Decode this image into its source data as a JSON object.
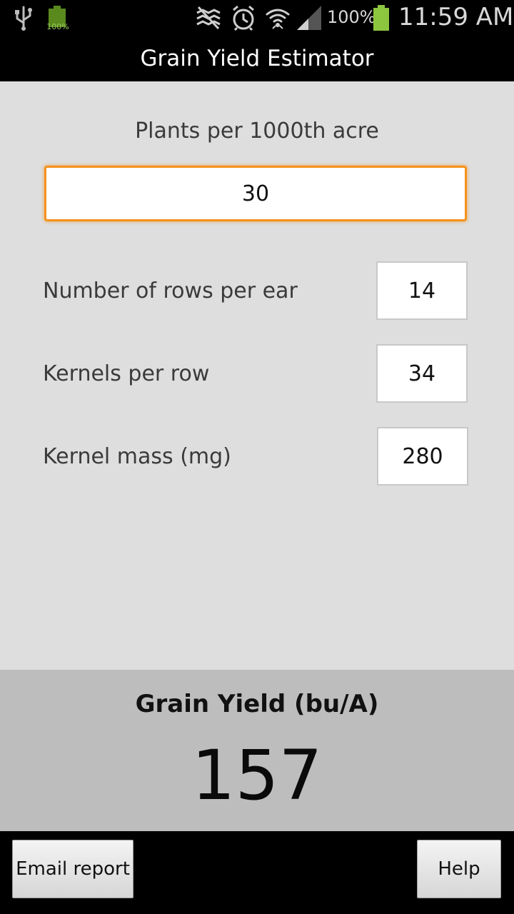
{
  "status_bar": {
    "battery_small_label": "100%",
    "battery_percent": "100%",
    "time": "11:59 AM",
    "icons": [
      "usb-icon",
      "battery-small-icon",
      "mute-icon",
      "alarm-icon",
      "wifi-icon",
      "signal-icon",
      "battery-icon"
    ],
    "battery_color": "#8cc63f"
  },
  "app": {
    "title": "Grain Yield Estimator"
  },
  "form": {
    "plants_label": "Plants per 1000th acre",
    "plants_value": "30",
    "rows_label": "Number of rows per ear",
    "rows_value": "14",
    "kernels_label": "Kernels per row",
    "kernels_value": "34",
    "mass_label": "Kernel mass (mg)",
    "mass_value": "280",
    "focus_color": "#f4921e"
  },
  "result": {
    "label": "Grain Yield (bu/A)",
    "value": "157"
  },
  "buttons": {
    "email": "Email report",
    "help": "Help"
  }
}
